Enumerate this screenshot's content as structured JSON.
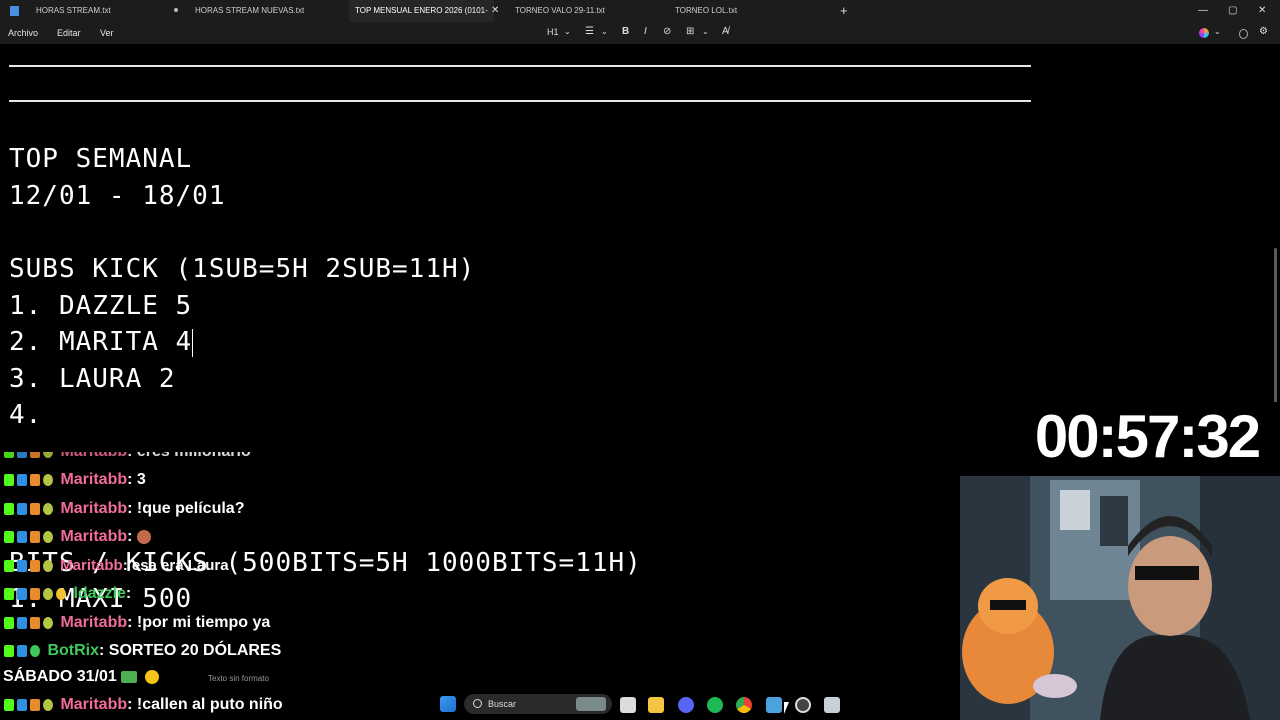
{
  "tabs": [
    {
      "label": "HORAS STREAM.txt",
      "modified": false
    },
    {
      "label": "HORAS STREAM NUEVAS.txt",
      "modified": true
    },
    {
      "label": "TOP MENSUAL ENERO 2026 (0101-",
      "active": true
    },
    {
      "label": "TORNEO VALO 29-11.txt",
      "modified": false
    },
    {
      "label": "TORNEO LOL.txt",
      "modified": false
    }
  ],
  "new_tab_symbol": "+",
  "close_symbol": "✕",
  "window_controls": {
    "minimize": "—",
    "maximize": "▢",
    "close": "✕"
  },
  "menu": {
    "file": "Archivo",
    "edit": "Editar",
    "view": "Ver"
  },
  "toolbar": {
    "heading": "H1",
    "list": "☰",
    "bold": "B",
    "italic": "I",
    "link": "⊘",
    "table": "⊞",
    "clear": "A̸"
  },
  "editor": {
    "title": "TOP SEMANAL",
    "date_range": "12/01 - 18/01",
    "subs_header": "SUBS KICK (1SUB=5H 2SUB=11H)",
    "subs": [
      "1. DAZZLE 5",
      "2. MARITA 4",
      "3. LAURA 2",
      "4."
    ],
    "bits_header": "BITS / KICKS (500BITS=5H 1000BITS=11H)",
    "bits": [
      "1. MAXI 500"
    ]
  },
  "timer": "00:57:32",
  "chat": [
    {
      "user": "Maritabb",
      "text": ": eres millonario",
      "bot": false
    },
    {
      "user": "Maritabb",
      "text": ": 3",
      "bot": false
    },
    {
      "user": "Maritabb",
      "text": ": !que película?",
      "bot": false
    },
    {
      "user": "Maritabb",
      "text": ": ",
      "bot": false
    },
    {
      "user": "Maritabb",
      "text": ": esa era Laura",
      "bot": false
    },
    {
      "user": "ldazzle",
      "text": ": ",
      "bot": false
    },
    {
      "user": "Maritabb",
      "text": ": !por mi tiempo ya",
      "bot": false
    },
    {
      "user": "BotRix",
      "text": ": SORTEO 20 DÓLARES",
      "bot": true
    },
    {
      "user": "Maritabb",
      "text": ": !callen al puto niño",
      "bot": false
    }
  ],
  "overlay_date": "SÁBADO 31/01",
  "status_hint": "Texto sin formato",
  "taskbar": {
    "search_placeholder": "Buscar"
  },
  "colors": {
    "chat_user": "#f06c9b",
    "bot_user": "#3ec95a",
    "editor_bg": "#000000",
    "chrome_bg": "#1c1c1c"
  }
}
